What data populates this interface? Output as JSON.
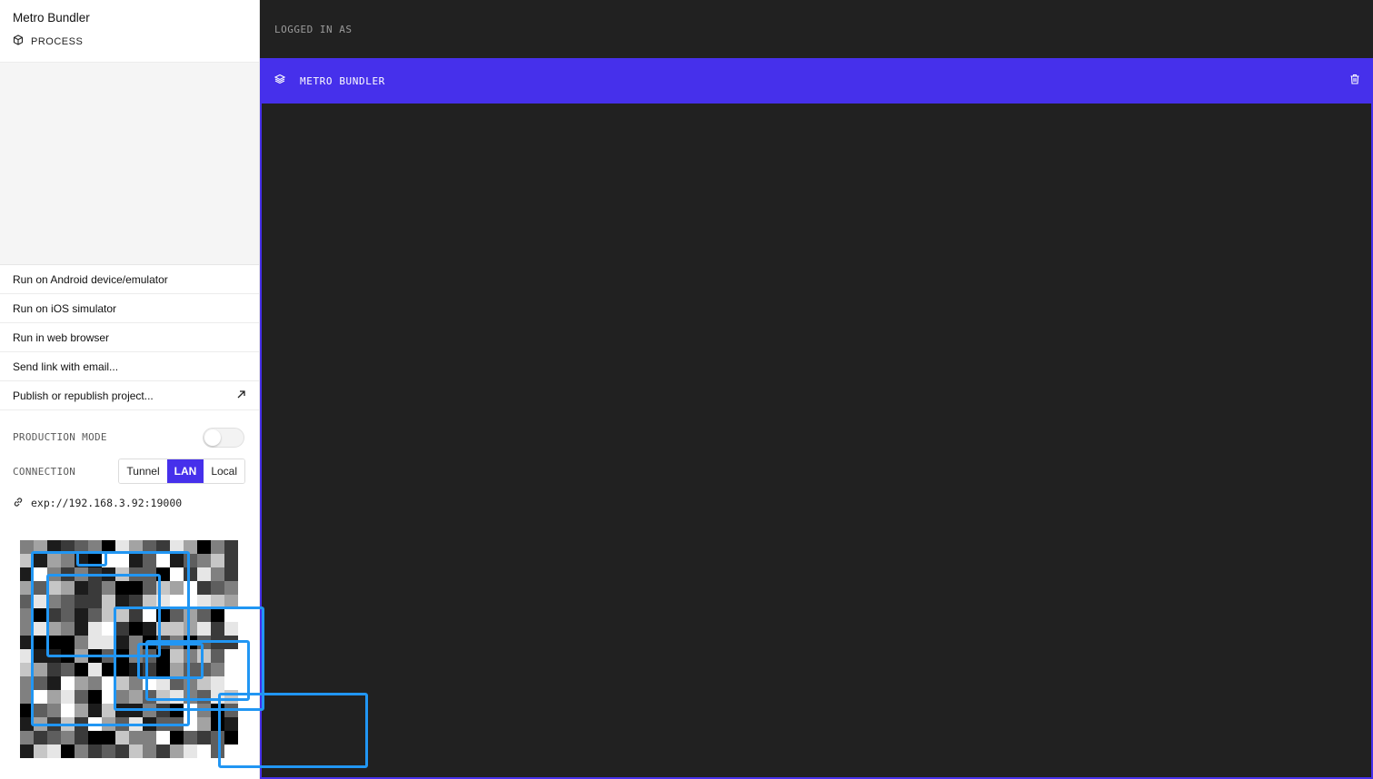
{
  "sidebar": {
    "project_name": "Metro Bundler",
    "process_label": "PROCESS",
    "actions": [
      {
        "label": "Run on Android device/emulator"
      },
      {
        "label": "Run on iOS simulator"
      },
      {
        "label": "Run in web browser"
      },
      {
        "label": "Send link with email..."
      },
      {
        "label": "Publish or republish project..."
      }
    ],
    "production_mode": {
      "label": "PRODUCTION MODE",
      "enabled": false
    },
    "connection": {
      "label": "CONNECTION",
      "options": [
        "Tunnel",
        "LAN",
        "Local"
      ],
      "selected": "LAN"
    },
    "url": "exp://192.168.3.92:19000"
  },
  "main": {
    "header_text": "LOGGED IN AS",
    "log_panel_title": "METRO BUNDLER"
  },
  "colors": {
    "accent": "#4630eb",
    "dark_background": "#212121",
    "overlay_box": "#2196f3"
  },
  "icons": [
    "cube-icon",
    "arrow-up-right-icon",
    "link-icon",
    "layers-icon",
    "trash-icon"
  ]
}
